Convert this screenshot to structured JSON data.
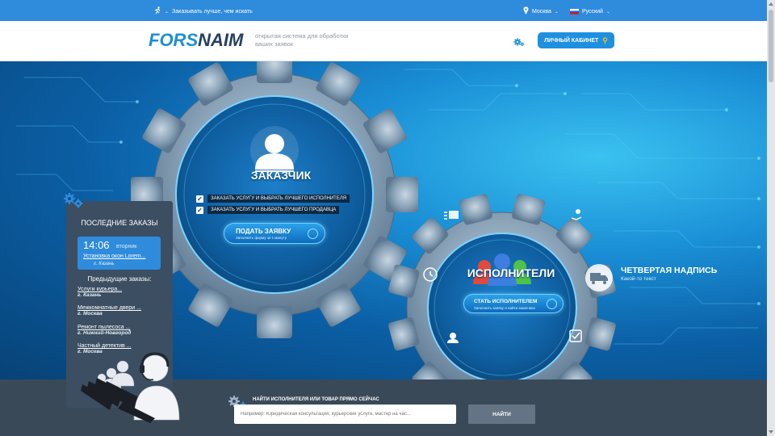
{
  "topbar": {
    "tagline": "Заказывать лучше, чем искать",
    "city": "Москва",
    "language": "Русский",
    "icons": [
      "runner-icon",
      "location-pin-icon",
      "russian-flag-icon"
    ]
  },
  "header": {
    "logo_part1": "FORS",
    "logo_part2": "NAIM",
    "tagline": "открытая система для обработки ваших заявок",
    "cabinet_label": "ЛИЧНЫЙ КАБИНЕТ"
  },
  "customer": {
    "title": "ЗАКАЗЧИК",
    "options": [
      "ЗАКАЗАТЬ УСЛУГУ И ВЫБРАТЬ ЛУЧШЕГО ИСПОЛНИТЕЛЯ",
      "ЗАКАЗАТЬ УСЛУГУ И ВЫБРАТЬ ЛУЧШЕГО ПРОДАВЦА"
    ],
    "button_label": "ПОДАТЬ ЗАЯВКУ",
    "button_sub": "Заполнить форму за 1 минуту"
  },
  "performers": {
    "title": "ИСПОЛНИТЕЛИ",
    "button_label": "СТАТЬ ИСПОЛНИТЕЛЕМ",
    "button_sub": "Заполнить заявку и найти заказчика"
  },
  "fourth": {
    "title": "ЧЕТВЕРТАЯ НАДПИСЬ",
    "subtitle": "Какой-то текст"
  },
  "orders": {
    "title": "ПОСЛЕДНИЕ ЗАКАЗЫ",
    "latest": {
      "time": "14:06",
      "day": "вторник",
      "service": "Установка окон Lorem...",
      "city": "г. Казань"
    },
    "previous_title": "Предыдущие заказы:",
    "previous": [
      {
        "name": "Услуги курьера...",
        "city": "г. Казань"
      },
      {
        "name": "Межкомнатные двери ...",
        "city": "г. Москва"
      },
      {
        "name": "Ремонт пылесоса ...",
        "city": "г. Нижний-Новгород"
      },
      {
        "name": "Частный детектив ...",
        "city": "г. Москва"
      }
    ]
  },
  "search": {
    "label": "НАЙТИ ИСПОЛНИТЕЛЯ ИЛИ ТОВАР ПРЯМО СЕЙЧАС",
    "placeholder": "Например: Юридическая консультация, курьерские услуги, мастер на час...",
    "button_label": "НАЙТИ"
  },
  "colors": {
    "accent": "#2f8bdc",
    "dark_panel": "#3b4e62",
    "logo_blue": "#1b8fd6",
    "logo_dark": "#24415f"
  }
}
